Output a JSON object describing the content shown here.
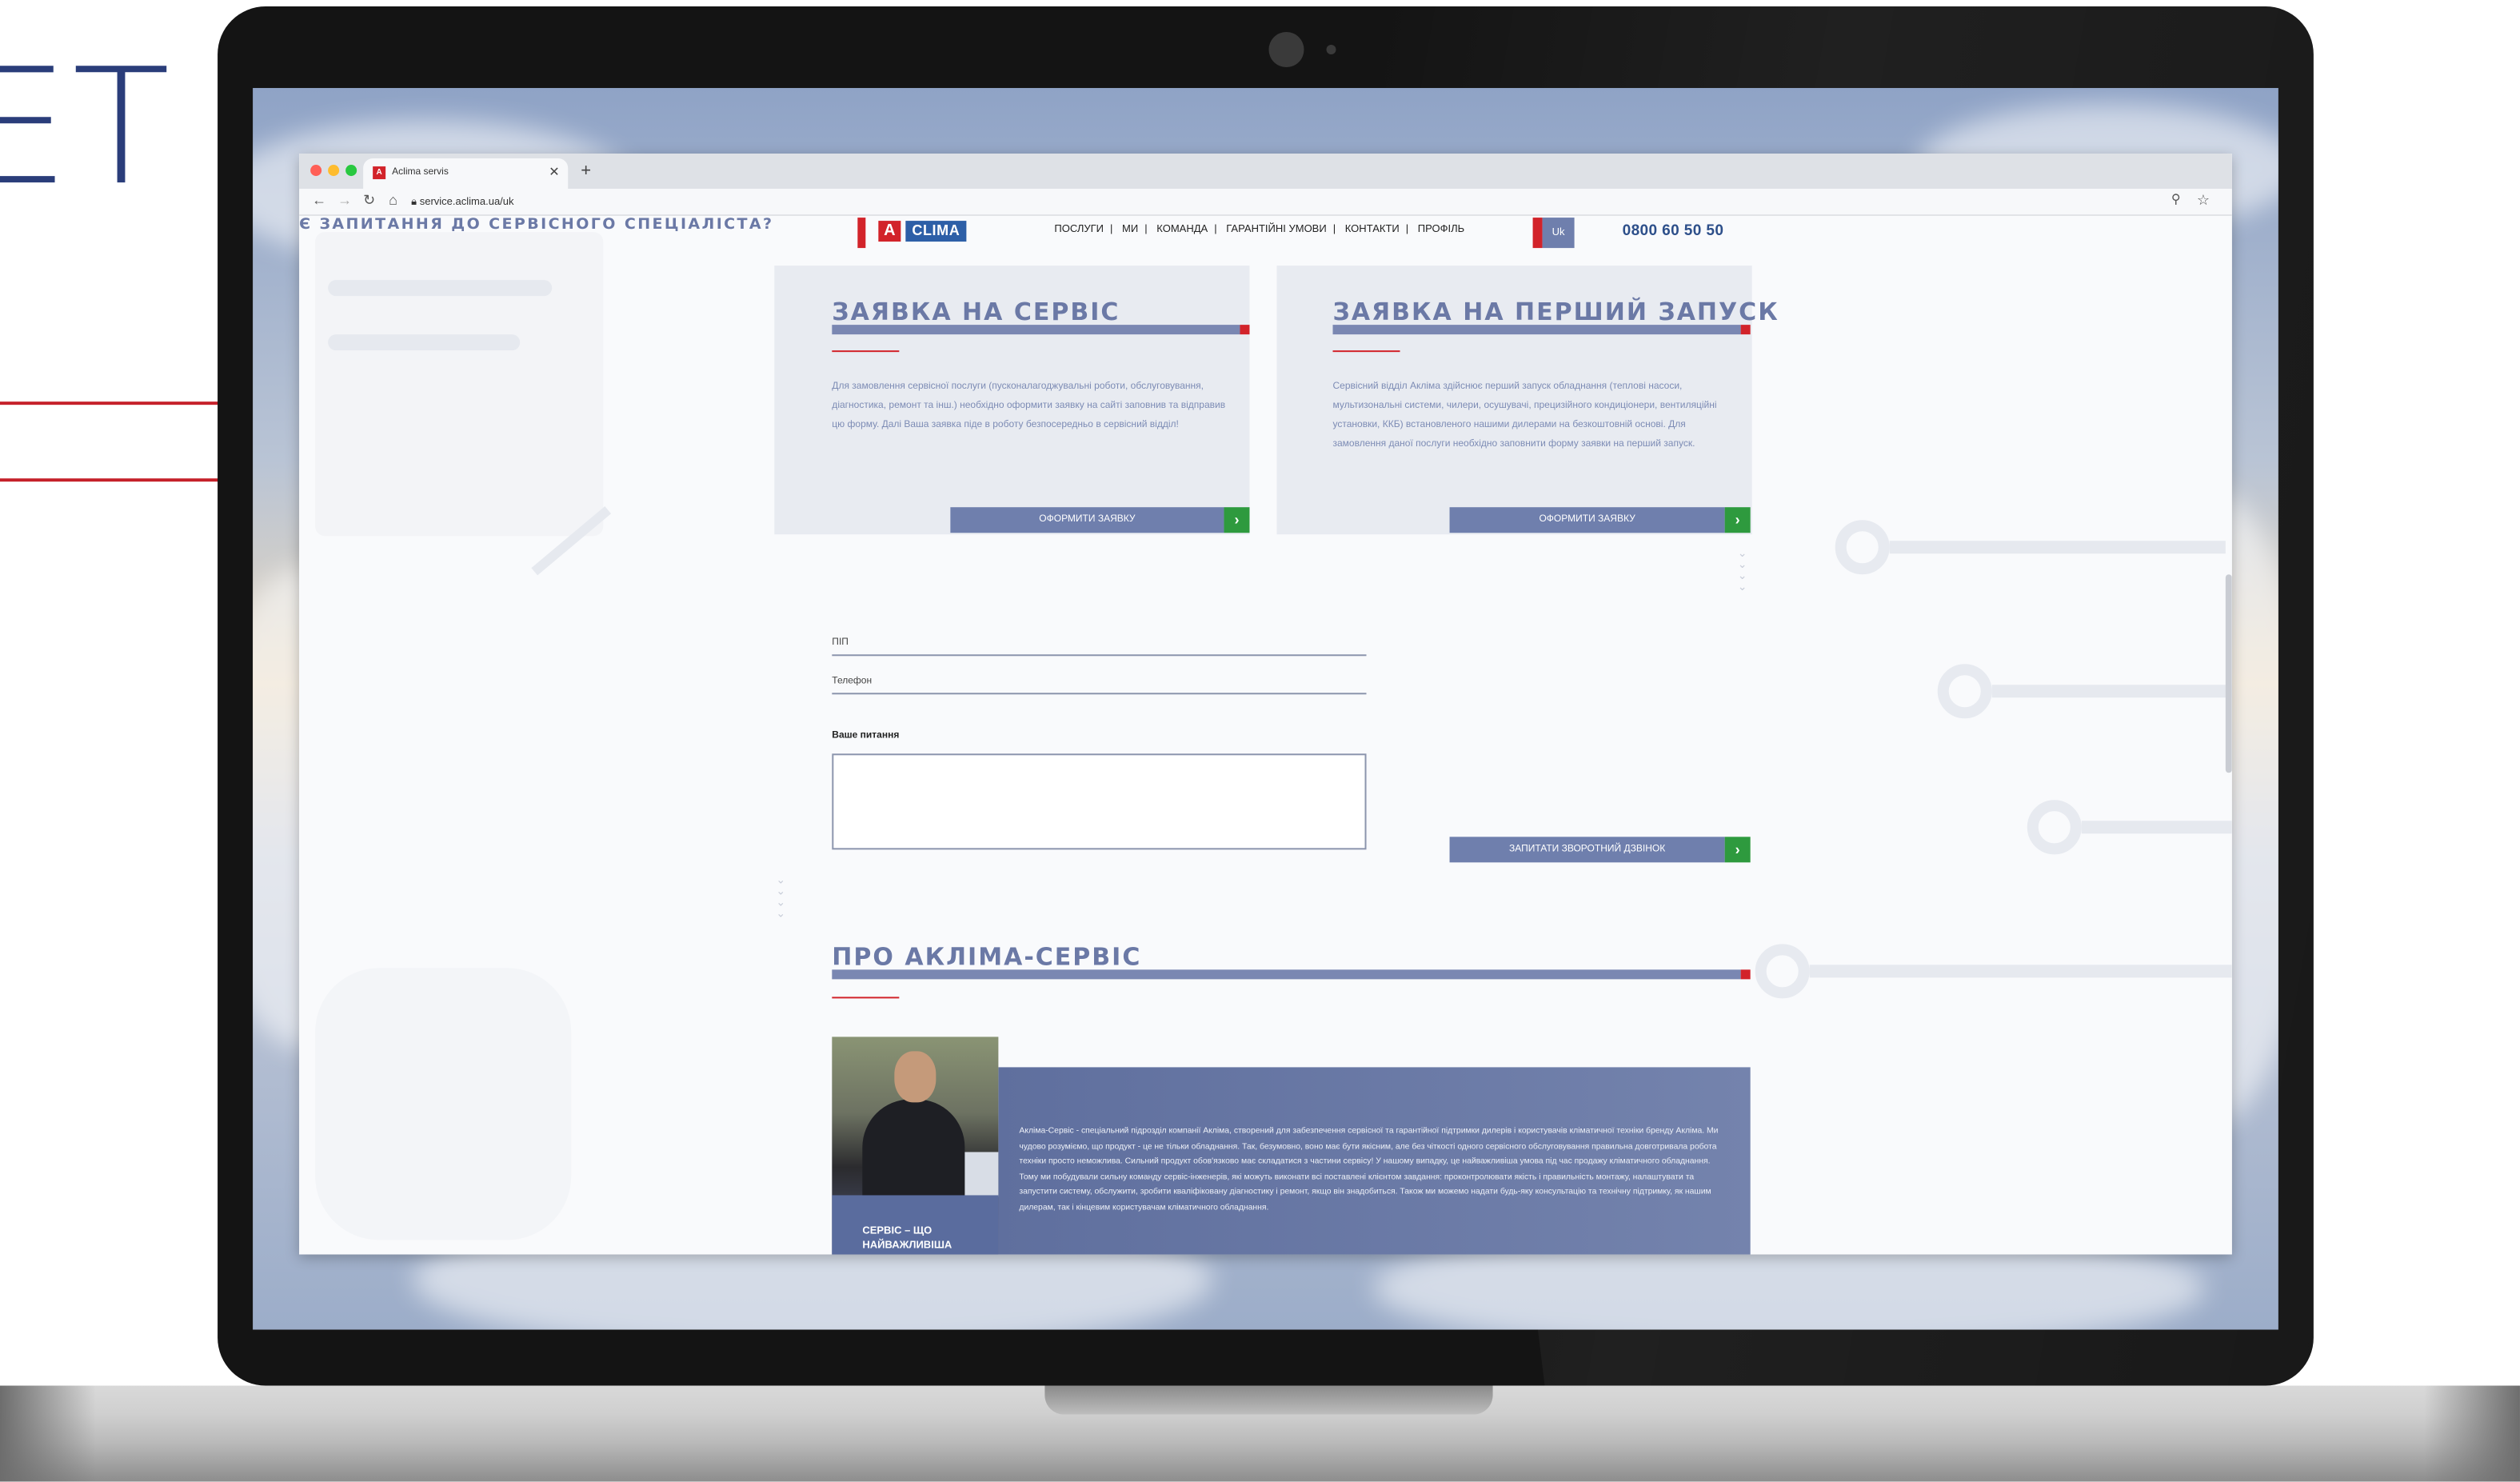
{
  "callout_text": "ET",
  "browser": {
    "tab_title": "Aclima servis",
    "tab_favicon": "A",
    "url": "service.aclima.ua/uk",
    "traffic_light_colors": [
      "#ff5f57",
      "#febc2e",
      "#28c840"
    ]
  },
  "header": {
    "logo_a": "A",
    "logo_text": "CLIMA",
    "nav": [
      "ПОСЛУГИ",
      "МИ",
      "КОМАНДА",
      "ГАРАНТІЙНІ УМОВИ",
      "КОНТАКТИ",
      "ПРОФІЛЬ"
    ],
    "nav_separator": "|",
    "lang": "Uk",
    "phone": "0800 60 50 50"
  },
  "cards": [
    {
      "title": "ЗАЯВКА НА СЕРВІС",
      "text": "Для замовлення сервісної послуги (пусконалагоджувальні роботи, обслуговування, діагностика, ремонт та інш.) необхідно оформити заявку на сайті заповнив та відправив цю форму. Далі Ваша заявка піде в роботу безпосередньо в сервісний відділ!",
      "button": "ОФОРМИТИ ЗАЯВКУ"
    },
    {
      "title": "ЗАЯВКА НА ПЕРШИЙ ЗАПУСК",
      "text": "Сервісний відділ Акліма здійснює перший запуск обладнання (теплові насоси, мультизональні системи, чилери, осушувачі, прецизійного кондиціонери, вентиляційні установки, ККБ) встановленого нашими дилерами на безкоштовній основі. Для замовлення даної послуги необхідно заповнити форму заявки на перший запуск.",
      "button": "ОФОРМИТИ ЗАЯВКУ"
    }
  ],
  "form": {
    "title": "Є ЗАПИТАННЯ ДО СЕРВІСНОГО СПЕЦІАЛІСТА?",
    "name_label": "ПІП",
    "phone_label": "Телефон",
    "question_label": "Ваше питання",
    "submit": "ЗАПИТАТИ ЗВОРОТНИЙ ДЗВІНОК"
  },
  "about": {
    "title": "ПРО АКЛІМА-СЕРВІС",
    "photo_caption": "СЕРВІС – ЩО НАЙВАЖЛИВІША",
    "text": "Акліма-Сервіс - спеціальний підрозділ компанії Акліма, створений для забезпечення сервісної та гарантійної підтримки дилерів і користувачів кліматичної техніки бренду Акліма. Ми чудово розуміємо, що продукт - це не тільки обладнання. Так, безумовно, воно має бути якісним, але без чіткості одного сервісного обслуговування правильна довготривала робота техніки просто неможлива. Сильний продукт обов'язково має складатися з частини сервісу! У нашому випадку, це найважливіша умова під час продажу кліматичного обладнання. Тому ми побудували сильну команду сервіс-інженерів, які можуть виконати всі поставлені клієнтом завдання: проконтролювати якість і правильність монтажу, налаштувати та запустити систему, обслужити, зробити кваліфіковану діагностику і ремонт, якщо він знадобиться. Також ми можемо надати будь-яку консультацію та технічну підтримку, як нашим дилерам, так і кінцевим користувачам кліматичного обладнання."
  },
  "colors": {
    "accent_red": "#d2232a",
    "brand_blue": "#2d5fa7",
    "title_blue": "#6b79a6",
    "button_blue": "#6f7fad",
    "arrow_green": "#2e9a3e"
  },
  "icons": [
    "back-arrow-icon",
    "forward-arrow-icon",
    "reload-icon",
    "home-icon",
    "lock-icon",
    "zoom-icon",
    "star-icon",
    "chevron-right-icon",
    "chevron-down-icon"
  ]
}
